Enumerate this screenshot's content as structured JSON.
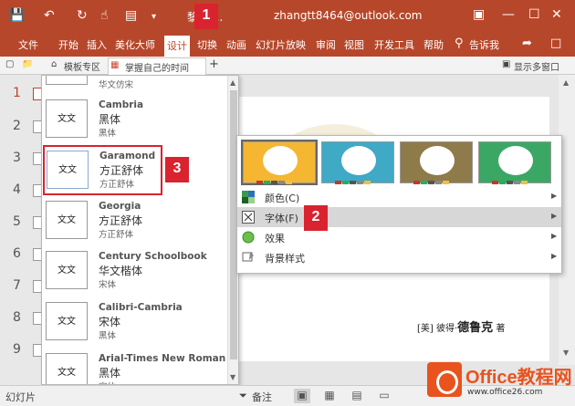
{
  "titlebar": {
    "title_fragment": "黎 白...",
    "email": "zhangtt8464@outlook.com",
    "quick_access": [
      "save-icon",
      "undo-icon",
      "redo-icon",
      "touch-icon",
      "present-icon"
    ]
  },
  "ribbon": {
    "tabs": [
      "文件",
      "开始",
      "插入",
      "美化大师",
      "设计",
      "切换",
      "动画",
      "幻灯片放映",
      "审阅",
      "视图",
      "开发工具",
      "帮助"
    ],
    "active_tab": "设计",
    "tell_me": "告诉我"
  },
  "tabsbar": {
    "template_zone": "模板专区",
    "doc_tab": "掌握自己的时间",
    "add": "+",
    "multi_window": "显示多窗口"
  },
  "slides": {
    "numbers": [
      "1",
      "2",
      "3",
      "4",
      "5",
      "6",
      "7",
      "8",
      "9"
    ]
  },
  "fonts": {
    "items": [
      {
        "name": "",
        "heading": "华文仿宋",
        "body": "",
        "thumb": "文文"
      },
      {
        "name": "Cambria",
        "heading": "黑体",
        "body": "黑体",
        "thumb": "文文"
      },
      {
        "name": "Garamond",
        "heading": "方正舒体",
        "body": "方正舒体",
        "thumb": "文文"
      },
      {
        "name": "Georgia",
        "heading": "方正舒体",
        "body": "方正舒体",
        "thumb": "文文"
      },
      {
        "name": "Century Schoolbook",
        "heading": "华文楷体",
        "body": "宋体",
        "thumb": "文文"
      },
      {
        "name": "Calibri-Cambria",
        "heading": "宋体",
        "body": "黑体",
        "thumb": "文文"
      },
      {
        "name": "Arial-Times New Roman",
        "heading": "黑体",
        "body": "宋体",
        "thumb": "文文"
      }
    ]
  },
  "design_menu": {
    "variant_colors": [
      "#f5b731",
      "#3fa9c6",
      "#8f7a4a",
      "#3aa864"
    ],
    "items": [
      {
        "label": "颜色(C)"
      },
      {
        "label": "字体(F)"
      },
      {
        "label": "效果"
      },
      {
        "label": "背景样式"
      }
    ]
  },
  "slide": {
    "author_prefix": "[美] 彼得·",
    "author_name": "德鲁克",
    "author_suffix": "著"
  },
  "statusbar": {
    "left": "幻灯片",
    "notes": "备注"
  },
  "badges": [
    "1",
    "2",
    "3"
  ],
  "watermark": {
    "text": "Office教程网",
    "url": "www.office26.com"
  }
}
